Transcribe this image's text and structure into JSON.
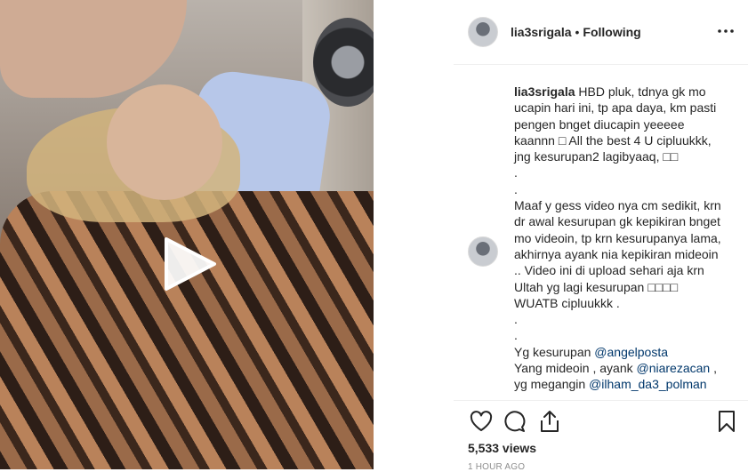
{
  "header": {
    "username": "lia3srigala",
    "separator": "•",
    "follow_status": "Following",
    "more_icon": "ellipsis-icon"
  },
  "media": {
    "type": "video",
    "play_icon": "play-icon"
  },
  "caption": {
    "username": "lia3srigala",
    "lines": [
      "HBD pluk, tdnya gk mo",
      "ucapin hari ini, tp apa daya, km pasti",
      "pengen bnget diucapin yeeeee",
      "kaannn □ All the best 4 U cipluukkk,",
      "jng kesurupan2 lagibyaaq, □□",
      ".",
      ".",
      "Maaf y gess video nya cm sedikit, krn",
      "dr awal kesurupan gk kepikiran bnget",
      "mo videoin, tp krn kesurupanya lama,",
      "akhirnya ayank nia kepikiran mideoin",
      ".. Video ini di upload sehari aja krn",
      "Ultah yg lagi kesurupan □□□□",
      "WUATB cipluukkk .",
      ".",
      "."
    ],
    "credit_1_prefix": "Yg kesurupan",
    "credit_1_mention": "@angelposta",
    "credit_2_prefix": "Yang mideoin , ayank",
    "credit_2_mention": "@niarezacan",
    "credit_2_suffix": ",",
    "credit_3_prefix": "yg megangin",
    "credit_3_mention": "@ilham_da3_polman"
  },
  "footer": {
    "views": "5,533 views",
    "timestamp": "1 HOUR AGO"
  },
  "colors": {
    "mention": "#00376b",
    "text": "#262626",
    "muted": "#8e8e8e",
    "border": "#efefef"
  }
}
